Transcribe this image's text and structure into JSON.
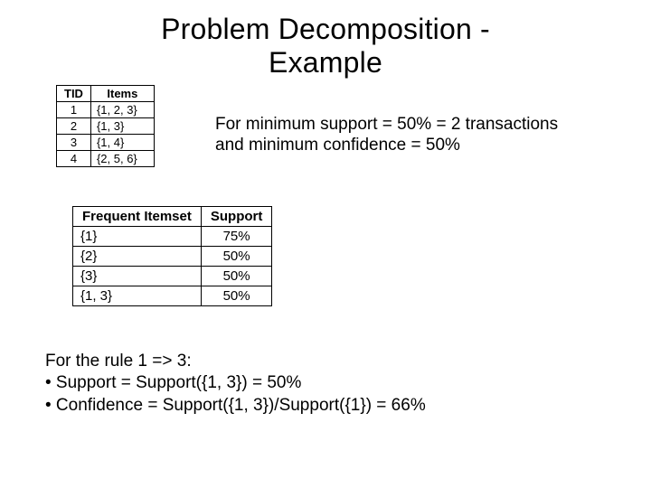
{
  "title_line1": "Problem Decomposition -",
  "title_line2": "Example",
  "trans_table": {
    "headers": [
      "TID",
      "Items"
    ],
    "rows": [
      {
        "tid": "1",
        "items": "{1, 2, 3}"
      },
      {
        "tid": "2",
        "items": "{1, 3}"
      },
      {
        "tid": "3",
        "items": "{1, 4}"
      },
      {
        "tid": "4",
        "items": "{2, 5, 6}"
      }
    ]
  },
  "support_text_line1": "For minimum support = 50% = 2 transactions",
  "support_text_line2": "and minimum confidence = 50%",
  "freq_table": {
    "headers": [
      "Frequent Itemset",
      "Support"
    ],
    "rows": [
      {
        "itemset": "{1}",
        "support": "75%"
      },
      {
        "itemset": "{2}",
        "support": "50%"
      },
      {
        "itemset": "{3}",
        "support": "50%"
      },
      {
        "itemset": "{1, 3}",
        "support": "50%"
      }
    ]
  },
  "rule": {
    "line1": "For the rule 1 => 3:",
    "line2": "• Support = Support({1, 3}) = 50%",
    "line3": "• Confidence = Support({1, 3})/Support({1}) = 66%"
  }
}
